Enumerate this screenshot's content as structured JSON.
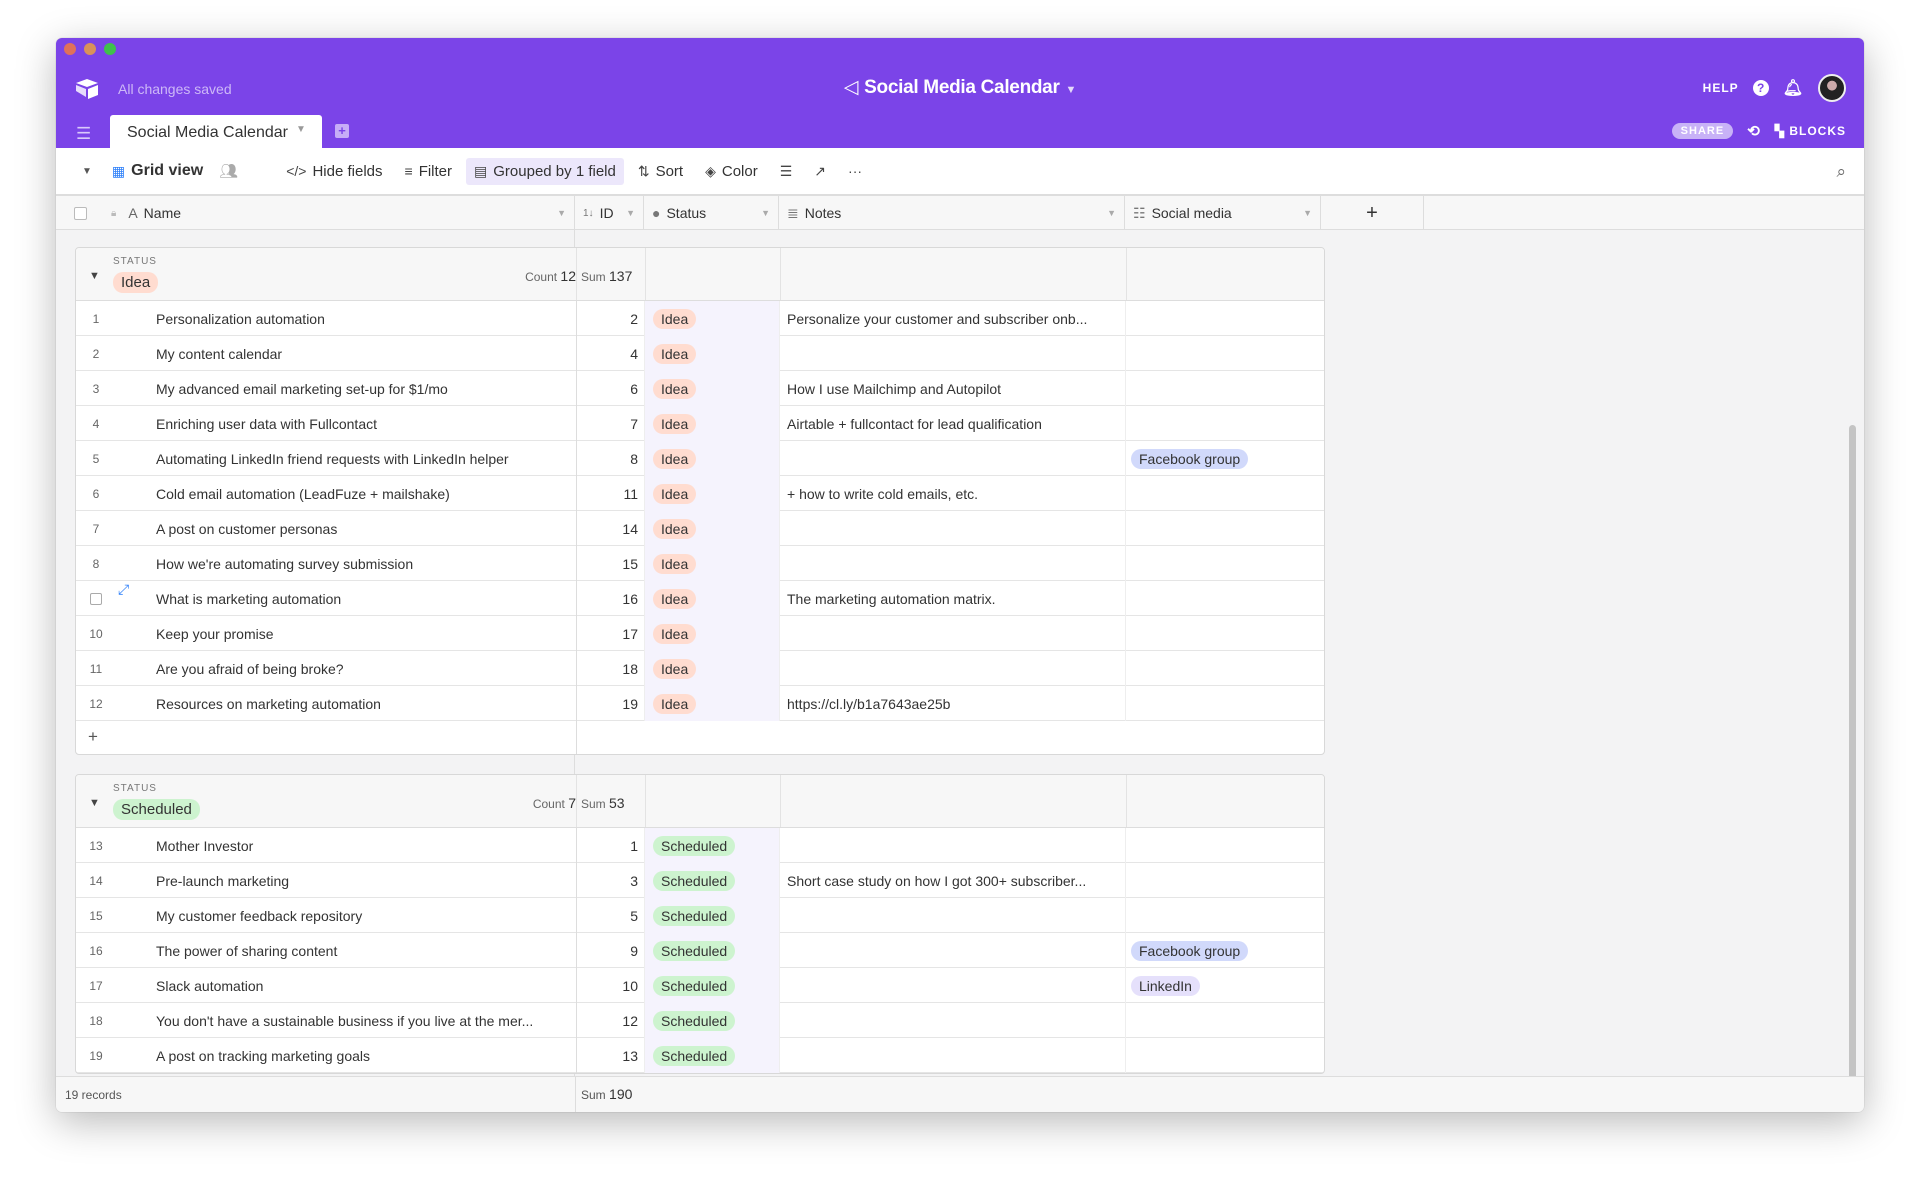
{
  "header": {
    "save_status": "All changes saved",
    "base_title": "Social Media Calendar",
    "help": "HELP",
    "share": "SHARE",
    "blocks": "BLOCKS"
  },
  "tabs": [
    {
      "label": "Social Media Calendar"
    }
  ],
  "toolbar": {
    "view": "Grid view",
    "hide_fields": "Hide fields",
    "filter": "Filter",
    "group": "Grouped by 1 field",
    "sort": "Sort",
    "color": "Color"
  },
  "columns": {
    "name": "Name",
    "id": "ID",
    "status": "Status",
    "notes": "Notes",
    "social": "Social media",
    "add": "+"
  },
  "colors": {
    "brand": "#7b44e8",
    "idea_bg": "#ffdcd0",
    "scheduled_bg": "#cdf3cf",
    "facebook_bg": "#d1d9fb",
    "linkedin_bg": "#e5e0fb"
  },
  "groups": [
    {
      "label": "STATUS",
      "value": "Idea",
      "count_label": "Count",
      "count": "12",
      "sum_label": "Sum",
      "sum": "137",
      "add": "+",
      "rows": [
        {
          "n": "1",
          "name": "Personalization automation",
          "id": "2",
          "status": "Idea",
          "notes": "Personalize your customer and subscriber onb...",
          "social": ""
        },
        {
          "n": "2",
          "name": "My content calendar",
          "id": "4",
          "status": "Idea",
          "notes": "",
          "social": ""
        },
        {
          "n": "3",
          "name": "My advanced email marketing set-up for $1/mo",
          "id": "6",
          "status": "Idea",
          "notes": "How I use Mailchimp and Autopilot",
          "social": ""
        },
        {
          "n": "4",
          "name": "Enriching user data with Fullcontact",
          "id": "7",
          "status": "Idea",
          "notes": "Airtable + fullcontact for lead qualification",
          "social": ""
        },
        {
          "n": "5",
          "name": "Automating LinkedIn friend requests with LinkedIn helper",
          "id": "8",
          "status": "Idea",
          "notes": "",
          "social": "Facebook group"
        },
        {
          "n": "6",
          "name": "Cold email automation (LeadFuze + mailshake)",
          "id": "11",
          "status": "Idea",
          "notes": "+ how to write cold emails, etc.",
          "social": ""
        },
        {
          "n": "7",
          "name": "A post on customer personas",
          "id": "14",
          "status": "Idea",
          "notes": "",
          "social": ""
        },
        {
          "n": "8",
          "name": "How we're automating survey submission",
          "id": "15",
          "status": "Idea",
          "notes": "",
          "social": ""
        },
        {
          "n": "",
          "name": "What is marketing automation",
          "id": "16",
          "status": "Idea",
          "notes": "The marketing automation matrix.",
          "social": ""
        },
        {
          "n": "10",
          "name": "Keep your promise",
          "id": "17",
          "status": "Idea",
          "notes": "",
          "social": ""
        },
        {
          "n": "11",
          "name": "Are you afraid of being broke?",
          "id": "18",
          "status": "Idea",
          "notes": "",
          "social": ""
        },
        {
          "n": "12",
          "name": "Resources on marketing automation",
          "id": "19",
          "status": "Idea",
          "notes": "https://cl.ly/b1a7643ae25b",
          "social": ""
        }
      ]
    },
    {
      "label": "STATUS",
      "value": "Scheduled",
      "count_label": "Count",
      "count": "7",
      "sum_label": "Sum",
      "sum": "53",
      "rows": [
        {
          "n": "13",
          "name": "Mother Investor",
          "id": "1",
          "status": "Scheduled",
          "notes": "",
          "social": ""
        },
        {
          "n": "14",
          "name": "Pre-launch marketing",
          "id": "3",
          "status": "Scheduled",
          "notes": "Short case study on how I got 300+ subscriber...",
          "social": ""
        },
        {
          "n": "15",
          "name": "My customer feedback repository",
          "id": "5",
          "status": "Scheduled",
          "notes": "",
          "social": ""
        },
        {
          "n": "16",
          "name": "The power of sharing content",
          "id": "9",
          "status": "Scheduled",
          "notes": "",
          "social": "Facebook group"
        },
        {
          "n": "17",
          "name": "Slack automation",
          "id": "10",
          "status": "Scheduled",
          "notes": "",
          "social": "LinkedIn"
        },
        {
          "n": "18",
          "name": "You don't have a sustainable business if you live at the mer...",
          "id": "12",
          "status": "Scheduled",
          "notes": "",
          "social": ""
        },
        {
          "n": "19",
          "name": "A post on tracking marketing goals",
          "id": "13",
          "status": "Scheduled",
          "notes": "",
          "social": ""
        }
      ]
    }
  ],
  "footer": {
    "records": "19 records",
    "sum_label": "Sum",
    "sum": "190"
  }
}
